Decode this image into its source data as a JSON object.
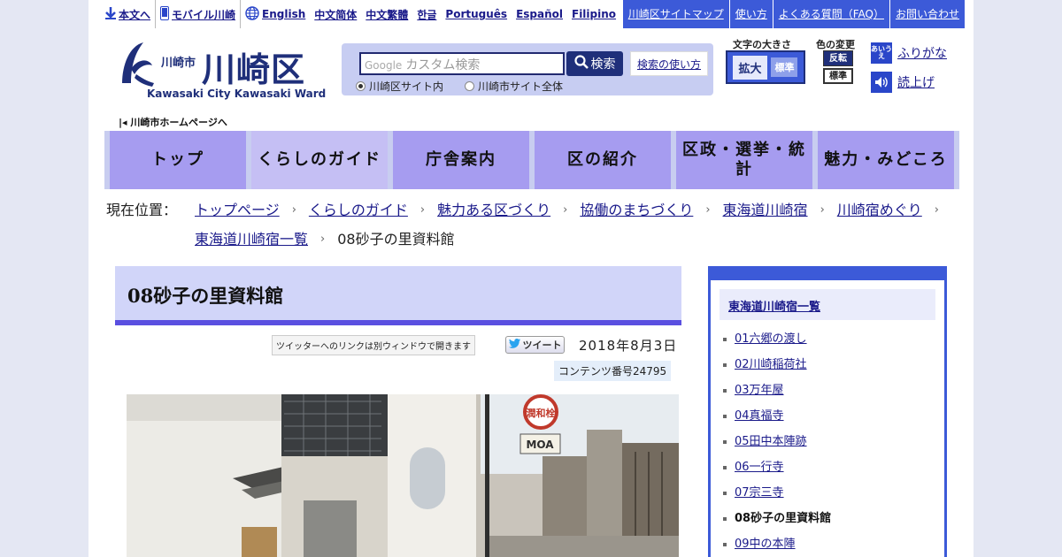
{
  "util": {
    "skip": "本文へ",
    "mobile": "モバイル川崎",
    "languages": [
      "English",
      "中文简体",
      "中文繁體",
      "한글",
      "Português",
      "Español",
      "Filipino"
    ]
  },
  "topnav": [
    "川崎区サイトマップ",
    "使い方",
    "よくある質問（FAQ）",
    "お問い合わせ"
  ],
  "logo": {
    "city": "川崎市",
    "ward": "川崎区",
    "english": "Kawasaki City Kawasaki Ward"
  },
  "home_link": "川崎市ホームページへ",
  "search": {
    "placeholder_brand": "Google",
    "placeholder": "カスタム検索",
    "button": "検索",
    "howto": "検索の使い方",
    "scope_ward": "川崎区サイト内",
    "scope_city": "川崎市サイト全体"
  },
  "textsize": {
    "label": "文字の大きさ",
    "enlarge": "拡大",
    "standard": "標準"
  },
  "colorchange": {
    "label": "色の変更",
    "reverse": "反転",
    "standard": "標準"
  },
  "furigana": {
    "icon": "あいうえ",
    "label": "ふりがな"
  },
  "readaloud": {
    "label": "読上げ"
  },
  "gnav": [
    "トップ",
    "くらしのガイド",
    "庁舎案内",
    "区の紹介",
    "区政・選挙・統計",
    "魅力・みどころ"
  ],
  "breadcrumb": {
    "label": "現在位置：",
    "items": [
      "トップページ",
      "くらしのガイド",
      "魅力ある区づくり",
      "協働のまちづくり",
      "東海道川崎宿",
      "川崎宿めぐり",
      "東海道川崎宿一覧"
    ],
    "current": "08砂子の里資料館"
  },
  "page": {
    "title": "08砂子の里資料館",
    "twitter_note": "ツイッターへのリンクは別ウィンドウで開きます",
    "tweet": "ツイート",
    "date": "2018年8月3日",
    "content_no": "コンテンツ番号24795"
  },
  "photo": {
    "sign_text": "潤和栓",
    "shop_sign": "MOA"
  },
  "sidebar": {
    "heading": "東海道川崎宿一覧",
    "items": [
      "01六郷の渡し",
      "02川崎稲荷社",
      "03万年屋",
      "04真福寺",
      "05田中本陣跡",
      "06一行寺",
      "07宗三寺",
      "08砂子の里資料館",
      "09中の本陣"
    ],
    "current_index": 7
  },
  "colors": {
    "accent": "#3c5ad8",
    "nav": "#a69cf0",
    "heading_bg": "#d1d5f9",
    "link": "#1a1a8a"
  }
}
